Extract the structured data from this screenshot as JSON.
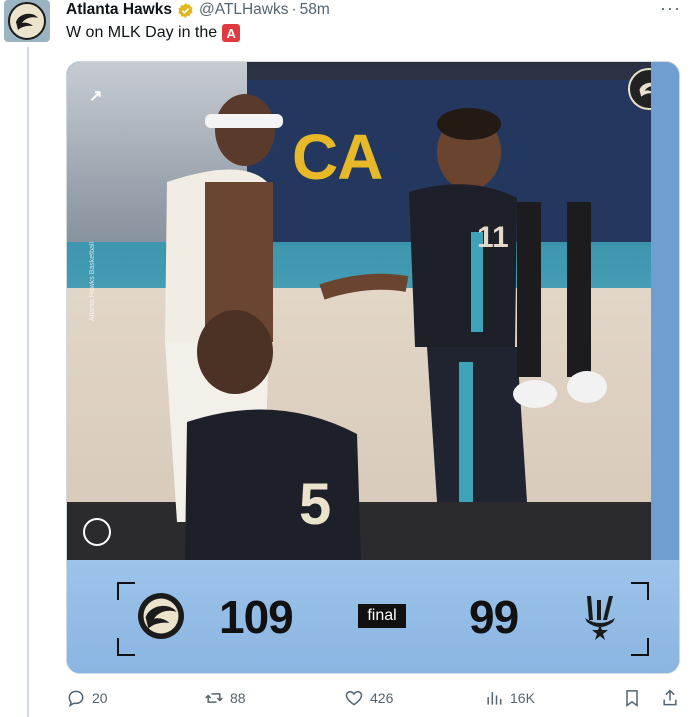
{
  "author": {
    "name": "Atlanta Hawks",
    "handle": "@ATLHawks",
    "time": "58m"
  },
  "tweet": {
    "text": "W on MLK Day in the"
  },
  "media": {
    "banner_text": "CA",
    "side_text": "Atlanta Hawks Basketball",
    "score": {
      "home_score": "109",
      "status": "final",
      "away_score": "99"
    }
  },
  "actions": {
    "replies": "20",
    "reposts": "88",
    "likes": "426",
    "views": "16K"
  },
  "colors": {
    "accent_red": "#e0393e",
    "score_panel": "#9cc3ea",
    "verified_gold": "#e2b719"
  }
}
